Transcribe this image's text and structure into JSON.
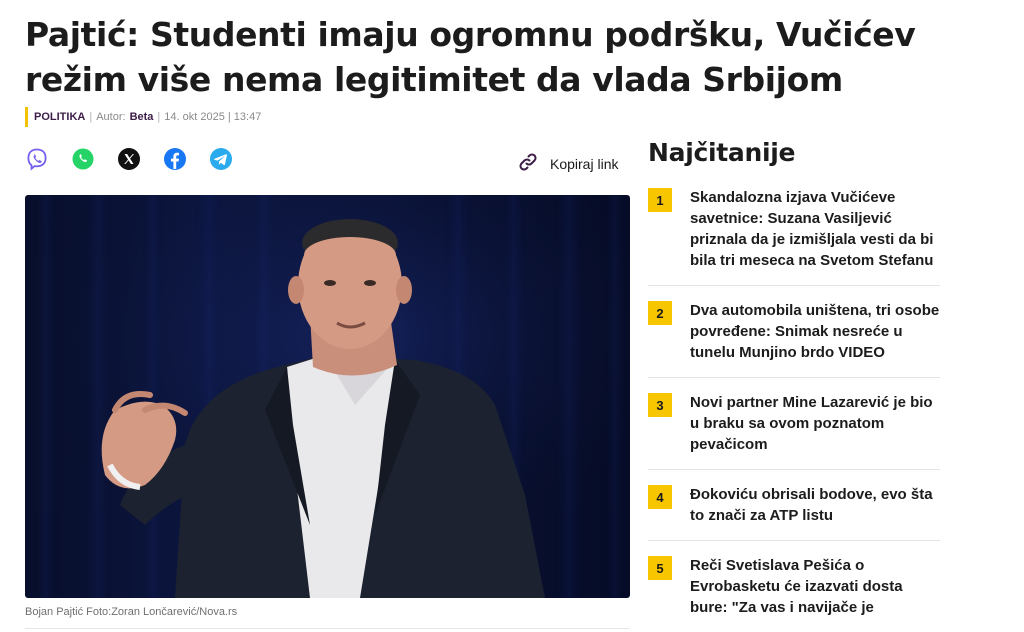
{
  "article": {
    "headline": "Pajtić: Studenti imaju ogromnu podršku, Vučićev režim više nema legitimitet da vlada Srbijom",
    "category": "POLITIKA",
    "author_label": "Autor:",
    "author": "Beta",
    "date": "14. okt 2025 | 13:47",
    "image_caption": "Bojan Pajtić Foto:Zoran Lončarević/Nova.rs"
  },
  "share": {
    "icons": [
      "viber-icon",
      "whatsapp-icon",
      "x-icon",
      "facebook-icon",
      "telegram-icon"
    ],
    "copy_link_label": "Kopiraj link"
  },
  "sidebar": {
    "title": "Najčitanije",
    "items": [
      {
        "rank": "1",
        "title": "Skandalozna izjava Vučićeve savetnice: Suzana Vasiljević priznala da je izmišljala vesti da bi bila tri meseca na Svetom Stefanu"
      },
      {
        "rank": "2",
        "title": "Dva automobila uništena, tri osobe povređene: Snimak nesreće u tunelu Munjino brdo VIDEO"
      },
      {
        "rank": "3",
        "title": "Novi partner Mine Lazarević je bio u braku sa ovom poznatom pevačicom"
      },
      {
        "rank": "4",
        "title": "Đokoviću obrisali bodove, evo šta to znači za ATP listu"
      },
      {
        "rank": "5",
        "title": "Reči Svetislava Pešića o Evrobasketu će izazvati dosta bure: \"Za vas i navijače je"
      }
    ]
  },
  "colors": {
    "accent_yellow": "#f7c600",
    "category_purple": "#3b1d47",
    "viber": "#7360f2",
    "whatsapp": "#25d366",
    "facebook": "#1877f2",
    "telegram": "#2aabee"
  }
}
